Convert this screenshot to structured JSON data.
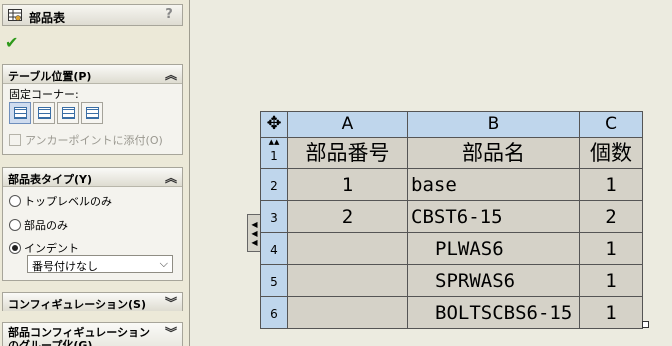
{
  "property_manager": {
    "title": "部品表",
    "help": "?",
    "ok_symbol": "✔",
    "table_position": {
      "header": "テーブル位置(P)",
      "fixed_corner_label": "固定コーナー:",
      "anchor_label": "アンカーポイントに添付(O)"
    },
    "bom_type": {
      "header": "部品表タイプ(Y)",
      "options": [
        "トップレベルのみ",
        "部品のみ",
        "インデント"
      ],
      "selected": "インデント",
      "numbering_value": "番号付けなし"
    },
    "configuration": {
      "header": "コンフィギュレーション(S)"
    },
    "part_config": {
      "header": "部品コンフィギュレーションのグループ化(G)"
    }
  },
  "table": {
    "columns": [
      "A",
      "B",
      "C"
    ],
    "row_numbers": [
      "1",
      "2",
      "3",
      "4",
      "5",
      "6"
    ],
    "header_row": [
      "部品番号",
      "部品名",
      "個数"
    ],
    "rows": [
      [
        "1",
        "base",
        "1"
      ],
      [
        "2",
        "CBST6-15",
        "2"
      ],
      [
        "",
        "PLWAS6",
        "1"
      ],
      [
        "",
        "SPRWAS6",
        "1"
      ],
      [
        "",
        "BOLTSCBS6-15",
        "1"
      ]
    ]
  },
  "colors": {
    "header_blue": "#bfd6ec",
    "cell_gray": "#d5d2c8",
    "ok_green": "#2e9a1b"
  }
}
